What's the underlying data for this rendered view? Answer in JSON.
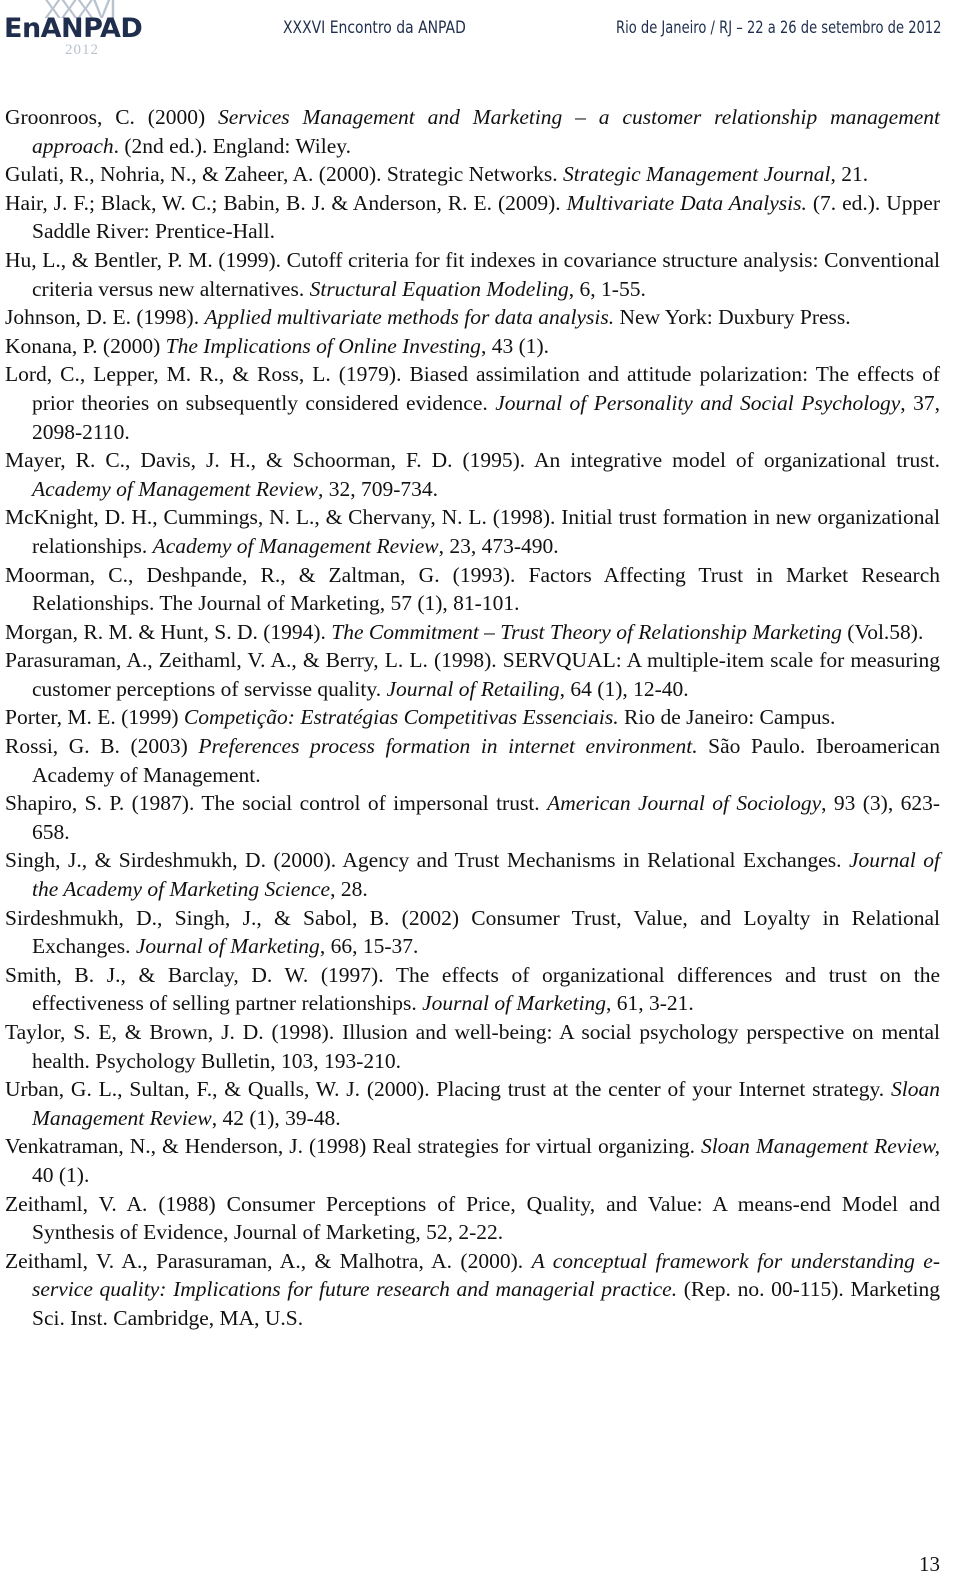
{
  "header": {
    "logo_roman": "XXXVI",
    "logo_name": "EnANPAD",
    "logo_year": "2012",
    "title": "XXXVI Encontro da ANPAD",
    "place_date": "Rio de Janeiro / RJ – 22 a 26 de setembro de 2012",
    "brand_color": "#1f2e4d",
    "accent_color": "#b9c3cf"
  },
  "references": [
    {
      "parts": [
        {
          "t": "Groonroos, C. (2000) "
        },
        {
          "t": "Services Management and Marketing – a customer relationship management approach",
          "i": true
        },
        {
          "t": ". (2nd ed.). England: Wiley."
        }
      ]
    },
    {
      "parts": [
        {
          "t": "Gulati, R., Nohria, N., & Zaheer, A. (2000). Strategic Networks. "
        },
        {
          "t": "Strategic Management Journal",
          "i": true
        },
        {
          "t": ", 21."
        }
      ]
    },
    {
      "parts": [
        {
          "t": "Hair, J. F.; Black, W. C.; Babin, B. J. & Anderson, R. E. (2009). "
        },
        {
          "t": "Multivariate Data Analysis.",
          "i": true
        },
        {
          "t": " (7. ed.). Upper Saddle River: Prentice-Hall."
        }
      ]
    },
    {
      "parts": [
        {
          "t": "Hu, L., & Bentler, P. M. (1999). Cutoff criteria for fit indexes in covariance structure analysis: Conventional criteria versus new alternatives. "
        },
        {
          "t": "Structural Equation Modeling",
          "i": true
        },
        {
          "t": ", 6, 1-55."
        }
      ]
    },
    {
      "parts": [
        {
          "t": "Johnson, D. E. (1998). "
        },
        {
          "t": "Applied multivariate methods for data analysis.",
          "i": true
        },
        {
          "t": " New York: Duxbury Press."
        }
      ]
    },
    {
      "parts": [
        {
          "t": "Konana, P. (2000) "
        },
        {
          "t": "The Implications of Online Investing",
          "i": true
        },
        {
          "t": ", 43 (1)."
        }
      ]
    },
    {
      "parts": [
        {
          "t": "Lord, C., Lepper, M. R., & Ross, L. (1979). Biased assimilation and attitude polarization: The effects of prior theories on subsequently considered evidence. "
        },
        {
          "t": "Journal of Personality and Social Psychology",
          "i": true
        },
        {
          "t": ", 37, 2098-2110."
        }
      ]
    },
    {
      "parts": [
        {
          "t": "Mayer, R. C., Davis, J. H., & Schoorman, F. D. (1995). An integrative model of organizational trust. "
        },
        {
          "t": "Academy of Management Review",
          "i": true
        },
        {
          "t": ", 32, 709-734."
        }
      ]
    },
    {
      "parts": [
        {
          "t": "McKnight, D. H., Cummings, N. L., & Chervany, N. L. (1998). Initial trust formation in new organizational relationships. "
        },
        {
          "t": "Academy of Management Review",
          "i": true
        },
        {
          "t": ", 23, 473-490."
        }
      ]
    },
    {
      "parts": [
        {
          "t": "Moorman, C., Deshpande, R., & Zaltman, G. (1993). Factors Affecting Trust in Market Research Relationships. The Journal of Marketing, 57 (1), 81-101."
        }
      ]
    },
    {
      "parts": [
        {
          "t": "Morgan, R. M. & Hunt, S. D. (1994). "
        },
        {
          "t": "The Commitment – Trust Theory of Relationship Marketing",
          "i": true
        },
        {
          "t": " (Vol.58)."
        }
      ]
    },
    {
      "parts": [
        {
          "t": "Parasuraman, A., Zeithaml, V. A., & Berry, L. L. (1998). SERVQUAL: A multiple-item scale for measuring customer perceptions of servisse quality. "
        },
        {
          "t": "Journal of Retailing",
          "i": true
        },
        {
          "t": ", 64 (1), 12-40."
        }
      ]
    },
    {
      "parts": [
        {
          "t": "Porter, M. E. (1999) "
        },
        {
          "t": "Competição: Estratégias Competitivas Essenciais.",
          "i": true
        },
        {
          "t": " Rio de Janeiro: Campus."
        }
      ]
    },
    {
      "parts": [
        {
          "t": "Rossi, G. B. (2003) "
        },
        {
          "t": "Preferences process formation in internet environment.",
          "i": true
        },
        {
          "t": " São Paulo. Iberoamerican Academy of Management."
        }
      ]
    },
    {
      "parts": [
        {
          "t": "Shapiro, S. P. (1987). The social control of impersonal trust. "
        },
        {
          "t": "American Journal of Sociology",
          "i": true
        },
        {
          "t": ", 93 (3), 623-658."
        }
      ]
    },
    {
      "parts": [
        {
          "t": "Singh, J., & Sirdeshmukh, D. (2000). Agency and Trust Mechanisms in Relational Exchanges. "
        },
        {
          "t": "Journal of the Academy of Marketing Science",
          "i": true
        },
        {
          "t": ", 28."
        }
      ]
    },
    {
      "parts": [
        {
          "t": "Sirdeshmukh, D., Singh, J., & Sabol, B. (2002) Consumer Trust, Value, and Loyalty in Relational Exchanges. "
        },
        {
          "t": "Journal of Marketing",
          "i": true
        },
        {
          "t": ", 66, 15-37."
        }
      ]
    },
    {
      "parts": [
        {
          "t": "Smith, B. J., & Barclay, D. W. (1997). The effects of organizational differences and trust on the effectiveness of selling partner relationships. "
        },
        {
          "t": "Journal of Marketing",
          "i": true
        },
        {
          "t": ", 61, 3-21."
        }
      ]
    },
    {
      "parts": [
        {
          "t": "Taylor, S. E, & Brown, J. D. (1998). Illusion and well-being: A social psychology perspective on mental health. Psychology Bulletin, 103, 193-210."
        }
      ]
    },
    {
      "parts": [
        {
          "t": "Urban, G. L., Sultan, F., & Qualls, W. J. (2000). Placing trust at the center of your Internet strategy. "
        },
        {
          "t": "Sloan Management Review",
          "i": true
        },
        {
          "t": ", 42 (1), 39-48."
        }
      ]
    },
    {
      "parts": [
        {
          "t": "Venkatraman, N., & Henderson, J. (1998) Real strategies for virtual organizing. "
        },
        {
          "t": "Sloan Management Review,",
          "i": true
        },
        {
          "t": " 40 (1)."
        }
      ]
    },
    {
      "parts": [
        {
          "t": "Zeithaml, V. A. (1988) Consumer Perceptions of Price, Quality, and Value: A means-end Model and Synthesis of Evidence, Journal of Marketing, 52, 2-22."
        }
      ]
    },
    {
      "parts": [
        {
          "t": "Zeithaml, V. A., Parasuraman, A., & Malhotra, A. (2000). "
        },
        {
          "t": "A conceptual framework for understanding e-service quality:  Implications for future research and managerial practice.",
          "i": true
        },
        {
          "t": "  (Rep.  no.  00-115). Marketing Sci. Inst. Cambridge, MA, U.S."
        }
      ]
    }
  ],
  "footer": {
    "page_number": "13"
  }
}
